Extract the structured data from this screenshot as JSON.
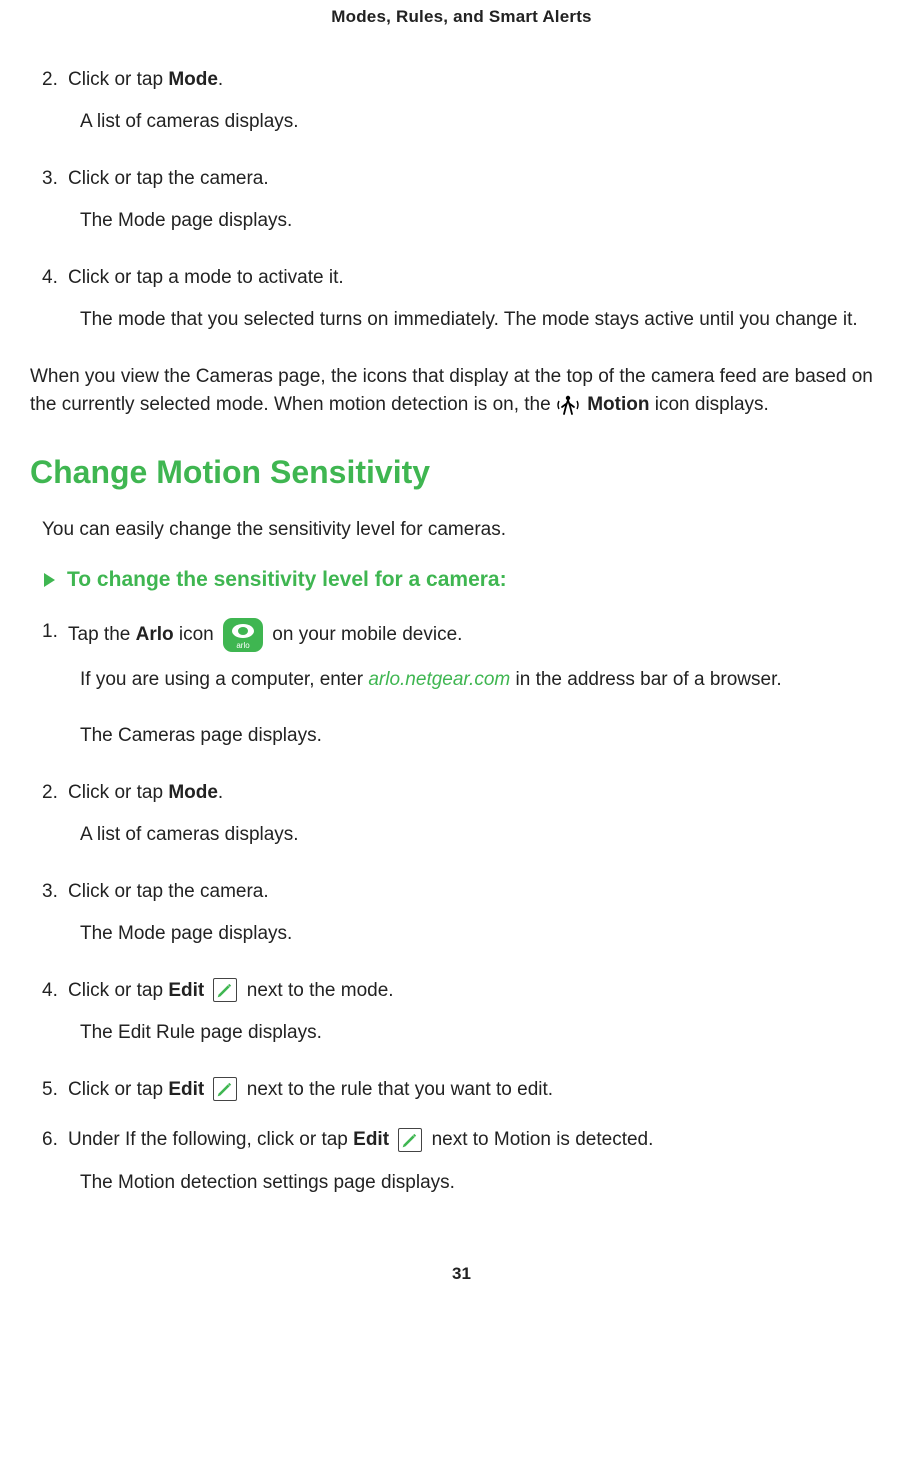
{
  "header": {
    "title": "Modes, Rules, and Smart Alerts"
  },
  "section1": {
    "step2": {
      "num": "2.",
      "main_a": "Click or tap ",
      "bold": "Mode",
      "main_c": ".",
      "desc": "A list of cameras displays."
    },
    "step3": {
      "num": "3.",
      "main": "Click or tap the camera.",
      "desc": "The Mode page displays."
    },
    "step4": {
      "num": "4.",
      "main": "Click or tap a mode to activate it.",
      "desc": "The mode that you selected turns on immediately. The mode stays active until you change it."
    },
    "para_a": "When you view the Cameras page, the icons that display at the top of the camera feed are based on the currently selected mode.  When motion detection is on, the ",
    "motion_bold": " Motion",
    "para_c": " icon displays."
  },
  "heading2": "Change Motion Sensitivity",
  "intro": "You can easily change the sensitivity level for  cameras.",
  "subhead": "To change the sensitivity level for a camera:",
  "section2": {
    "step1": {
      "num": "1.",
      "main_a": "Tap the ",
      "bold": "Arlo",
      "main_b": " icon ",
      "main_c": " on your mobile device.",
      "desc1_a": "If you are using a computer, enter ",
      "link": "arlo.netgear.com",
      "desc1_b": " in the address bar of a browser.",
      "desc2": "The Cameras page displays."
    },
    "step2": {
      "num": "2.",
      "main_a": "Click or tap ",
      "bold": "Mode",
      "main_c": ".",
      "desc": "A list of cameras displays."
    },
    "step3": {
      "num": "3.",
      "main": "Click or tap the  camera.",
      "desc": "The Mode page displays."
    },
    "step4": {
      "num": "4.",
      "main_a": "Click or tap ",
      "bold": "Edit",
      "main_b": " ",
      "main_c": " next to the mode.",
      "desc": "The Edit Rule page displays."
    },
    "step5": {
      "num": "5.",
      "main_a": "Click or tap ",
      "bold": "Edit",
      "main_b": " ",
      "main_c": "  next to the rule that you want to edit."
    },
    "step6": {
      "num": "6.",
      "main_a": "Under If the following, click or tap ",
      "bold": "Edit",
      "main_b": " ",
      "main_c": " next to Motion is detected.",
      "desc": "The Motion detection settings page displays."
    }
  },
  "pageNumber": "31",
  "icons": {
    "arlo": "arlo-icon",
    "edit": "edit-icon",
    "motion": "motion-icon"
  }
}
